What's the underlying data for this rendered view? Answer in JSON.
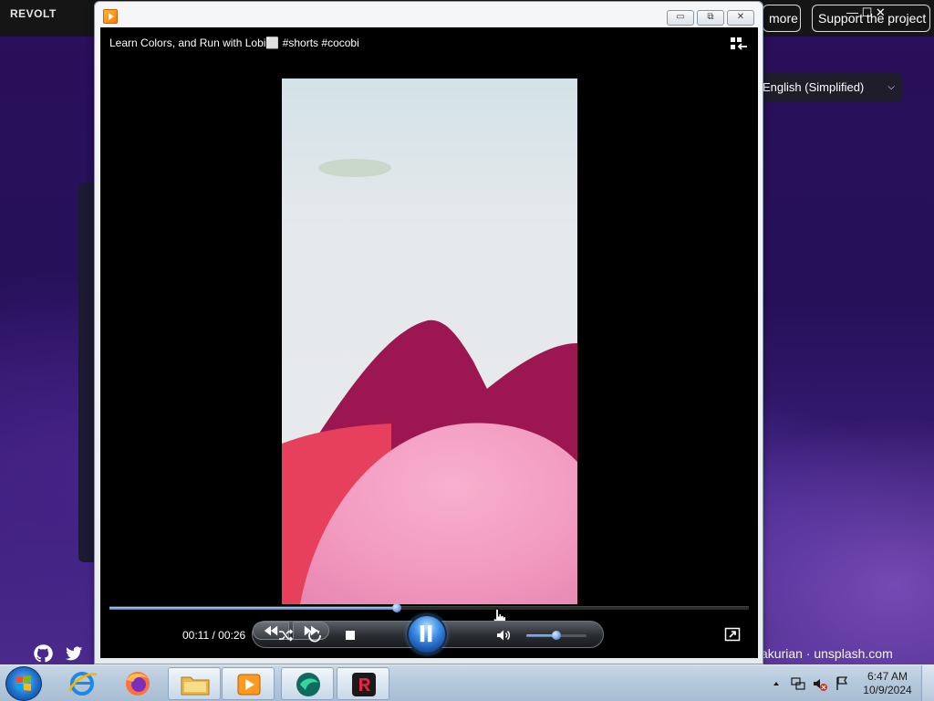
{
  "background_app": {
    "brand": "REVOLT",
    "more_label": "more",
    "support_label": "Support the project",
    "language": "English (Simplified)",
    "photo_credit": "akurian · unsplash.com",
    "window_controls": "—  ☐  ✕"
  },
  "player": {
    "title": "Learn Colors, and Run with Lobi⬜ #shorts #cocobi",
    "elapsed": "00:11",
    "duration": "00:26",
    "time_text": "00:11 / 00:26",
    "progress_fraction": 0.45,
    "volume_fraction": 0.5,
    "window_controls": {
      "minimize": "▭",
      "maximize": "⧉",
      "close": "✕"
    },
    "icons": {
      "app": "media-player-icon",
      "switch_library": "switch-to-library-icon",
      "shuffle": "shuffle-icon",
      "repeat": "repeat-icon",
      "stop": "stop-icon",
      "previous": "previous-icon",
      "play_pause": "pause-icon",
      "next": "next-icon",
      "mute": "speaker-icon",
      "fullscreen": "switch-to-now-playing-icon"
    }
  },
  "taskbar": {
    "items": [
      "start",
      "internet-explorer",
      "firefox",
      "file-explorer",
      "windows-media-player",
      "green-app",
      "revolt"
    ],
    "clock_time": "6:47 AM",
    "clock_date": "10/9/2024"
  },
  "colors": {
    "accent": "#3a7fd8",
    "video_bg": "#000000",
    "background_purple": "#2a0f5a"
  }
}
